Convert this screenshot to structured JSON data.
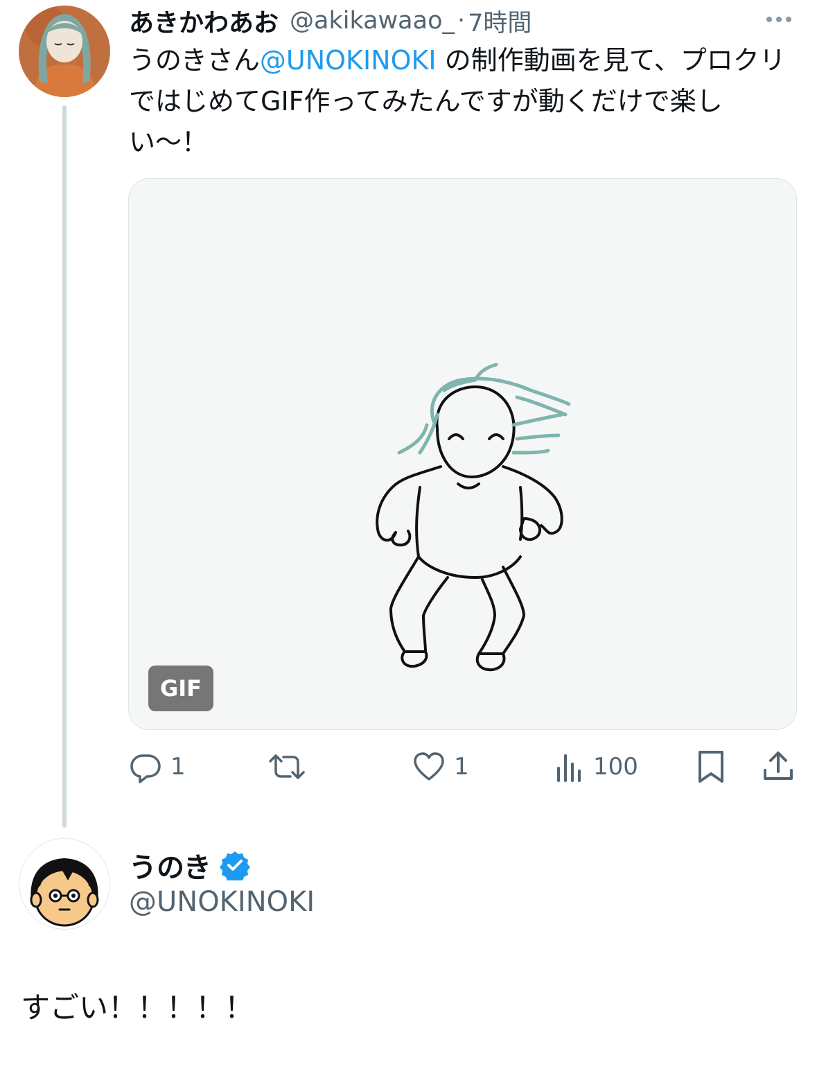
{
  "tweet": {
    "display_name": "あきかわあお",
    "handle": "@akikawaao_",
    "separator": "·",
    "time": "7時間",
    "text_before": "うのきさん",
    "mention": "@UNOKINOKI",
    "text_after": " の制作動画を見て、プロクリではじめてGIF作ってみたんですが動くだけで楽しい〜！",
    "media_badge": "GIF",
    "actions": {
      "replies": "1",
      "likes": "1",
      "views": "100"
    }
  },
  "reply": {
    "display_name": "うのき",
    "verified": true,
    "handle": "@UNOKINOKI",
    "text": "すごい！！！！！"
  },
  "colors": {
    "accent": "#1d9bf0",
    "secondary_text": "#536471",
    "thread_line": "#cfd9de",
    "verified_badge": "#1d9bf0"
  },
  "icons": [
    "more-icon",
    "reply-icon",
    "retweet-icon",
    "like-icon",
    "views-icon",
    "bookmark-icon",
    "share-icon",
    "verified-badge-icon"
  ]
}
